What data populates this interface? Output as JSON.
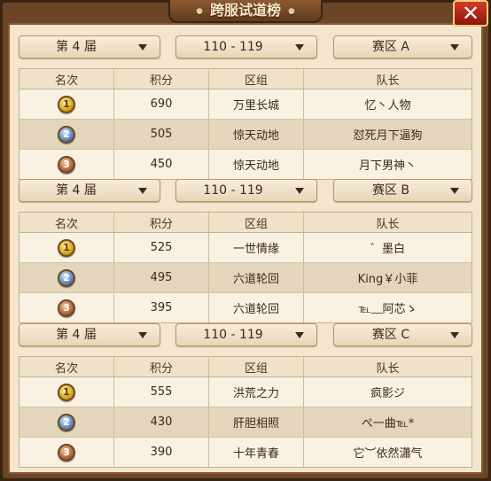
{
  "title": "跨服试道榜",
  "close_symbol": "✕",
  "columns": [
    "名次",
    "积分",
    "区组",
    "队长"
  ],
  "sections": [
    {
      "session": "第 4 届",
      "level_range": "110 - 119",
      "zone": "赛区 A",
      "rows": [
        {
          "rank": "1",
          "medal": "gold",
          "score": "690",
          "group": "万里长城",
          "captain": "忆丶人物"
        },
        {
          "rank": "2",
          "medal": "silver",
          "score": "505",
          "group": "惊天动地",
          "captain": "怼死月下逼狗"
        },
        {
          "rank": "3",
          "medal": "bronze",
          "score": "450",
          "group": "惊天动地",
          "captain": "月下男神丶"
        }
      ]
    },
    {
      "session": "第 4 届",
      "level_range": "110 - 119",
      "zone": "赛区 B",
      "rows": [
        {
          "rank": "1",
          "medal": "gold",
          "score": "525",
          "group": "一世情缘",
          "captain": "゛墨白"
        },
        {
          "rank": "2",
          "medal": "silver",
          "score": "495",
          "group": "六道轮回",
          "captain": "King￥小菲"
        },
        {
          "rank": "3",
          "medal": "bronze",
          "score": "395",
          "group": "六道轮回",
          "captain": "℡﹏阿芯ゝ"
        }
      ]
    },
    {
      "session": "第 4 届",
      "level_range": "110 - 119",
      "zone": "赛区 C",
      "rows": [
        {
          "rank": "1",
          "medal": "gold",
          "score": "555",
          "group": "洪荒之力",
          "captain": "疯影ジ"
        },
        {
          "rank": "2",
          "medal": "silver",
          "score": "430",
          "group": "肝胆相照",
          "captain": "ぺ一曲℡*"
        },
        {
          "rank": "3",
          "medal": "bronze",
          "score": "390",
          "group": "十年青春",
          "captain": "它︶依然瀟气"
        }
      ]
    }
  ]
}
